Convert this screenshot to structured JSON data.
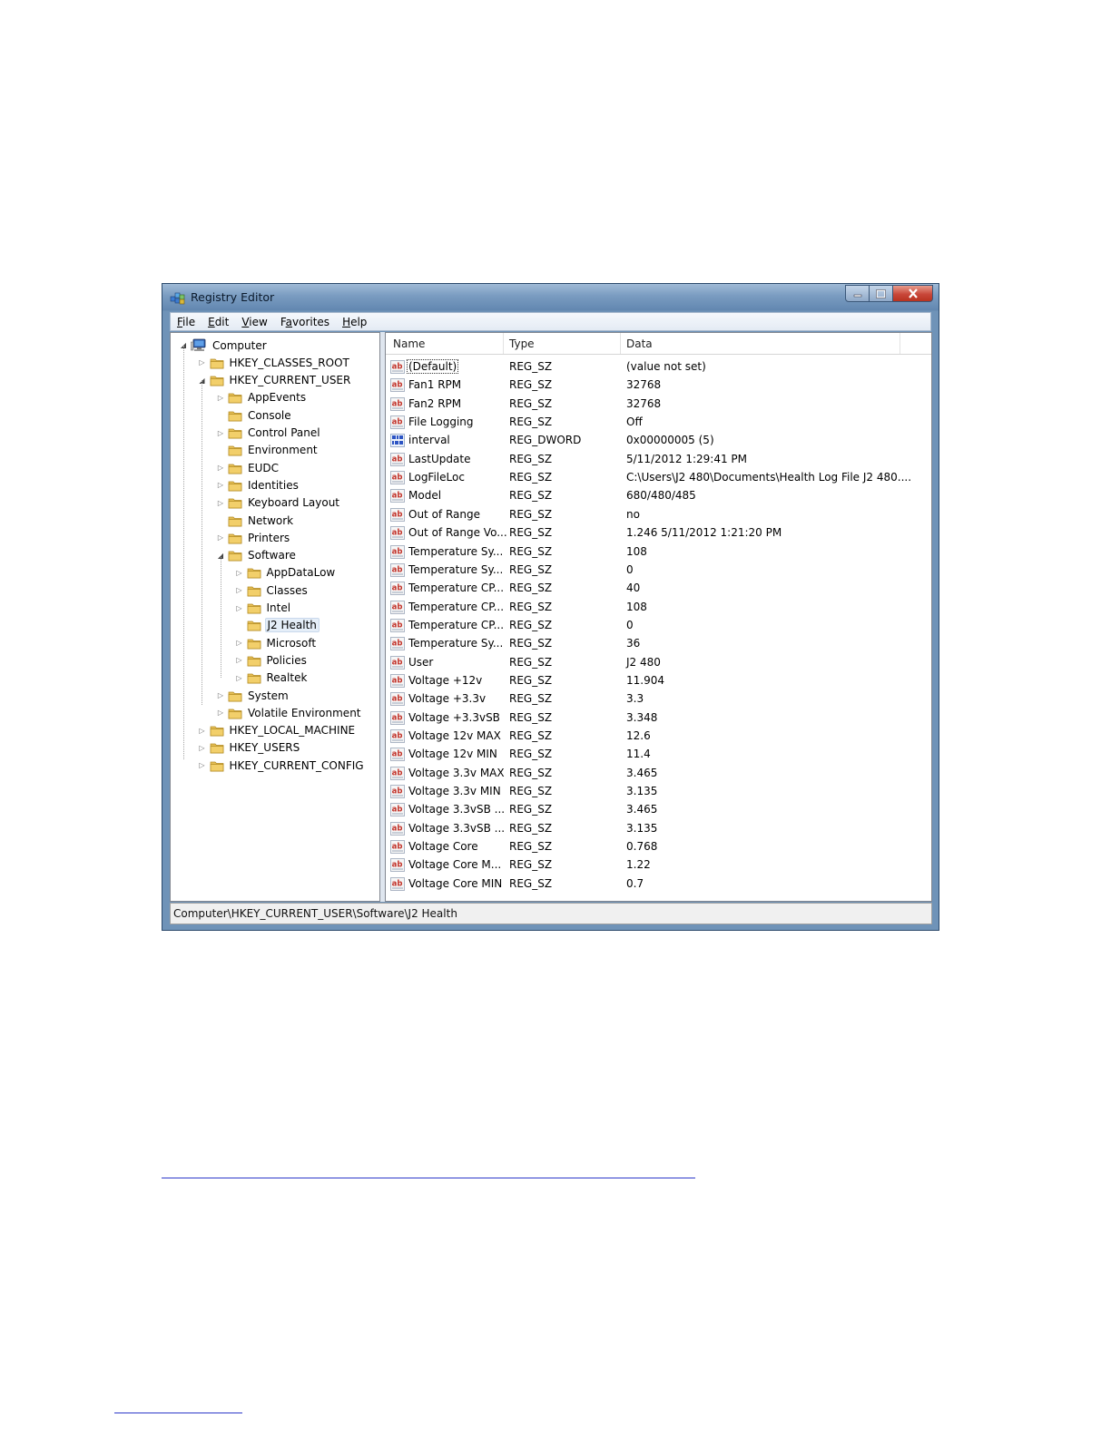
{
  "window": {
    "title": "Registry Editor"
  },
  "menu": [
    {
      "label": "File",
      "underline": "F",
      "rest": "ile"
    },
    {
      "label": "Edit",
      "underline": "E",
      "rest": "dit"
    },
    {
      "label": "View",
      "underline": "V",
      "rest": "iew"
    },
    {
      "label": "Favorites",
      "underline": "a",
      "pre": "F",
      "rest": "vorites"
    },
    {
      "label": "Help",
      "underline": "H",
      "rest": "elp"
    }
  ],
  "tree": [
    {
      "label": "Computer",
      "level": 0,
      "expander": "open",
      "icon": "computer-icon"
    },
    {
      "label": "HKEY_CLASSES_ROOT",
      "level": 1,
      "expander": "closed",
      "icon": "folder-icon"
    },
    {
      "label": "HKEY_CURRENT_USER",
      "level": 1,
      "expander": "open",
      "icon": "folder-icon"
    },
    {
      "label": "AppEvents",
      "level": 2,
      "expander": "closed",
      "icon": "folder-icon"
    },
    {
      "label": "Console",
      "level": 2,
      "expander": "none",
      "icon": "folder-icon"
    },
    {
      "label": "Control Panel",
      "level": 2,
      "expander": "closed",
      "icon": "folder-icon"
    },
    {
      "label": "Environment",
      "level": 2,
      "expander": "none",
      "icon": "folder-icon"
    },
    {
      "label": "EUDC",
      "level": 2,
      "expander": "closed",
      "icon": "folder-icon"
    },
    {
      "label": "Identities",
      "level": 2,
      "expander": "closed",
      "icon": "folder-icon"
    },
    {
      "label": "Keyboard Layout",
      "level": 2,
      "expander": "closed",
      "icon": "folder-icon"
    },
    {
      "label": "Network",
      "level": 2,
      "expander": "none",
      "icon": "folder-icon"
    },
    {
      "label": "Printers",
      "level": 2,
      "expander": "closed",
      "icon": "folder-icon"
    },
    {
      "label": "Software",
      "level": 2,
      "expander": "open",
      "icon": "folder-icon"
    },
    {
      "label": "AppDataLow",
      "level": 3,
      "expander": "closed",
      "icon": "folder-icon"
    },
    {
      "label": "Classes",
      "level": 3,
      "expander": "closed",
      "icon": "folder-icon"
    },
    {
      "label": "Intel",
      "level": 3,
      "expander": "closed",
      "icon": "folder-icon"
    },
    {
      "label": "J2 Health",
      "level": 3,
      "expander": "none",
      "icon": "folder-icon",
      "selected": true
    },
    {
      "label": "Microsoft",
      "level": 3,
      "expander": "closed",
      "icon": "folder-icon"
    },
    {
      "label": "Policies",
      "level": 3,
      "expander": "closed",
      "icon": "folder-icon"
    },
    {
      "label": "Realtek",
      "level": 3,
      "expander": "closed",
      "icon": "folder-icon"
    },
    {
      "label": "System",
      "level": 2,
      "expander": "closed",
      "icon": "folder-icon"
    },
    {
      "label": "Volatile Environment",
      "level": 2,
      "expander": "closed",
      "icon": "folder-icon"
    },
    {
      "label": "HKEY_LOCAL_MACHINE",
      "level": 1,
      "expander": "closed",
      "icon": "folder-icon"
    },
    {
      "label": "HKEY_USERS",
      "level": 1,
      "expander": "closed",
      "icon": "folder-icon"
    },
    {
      "label": "HKEY_CURRENT_CONFIG",
      "level": 1,
      "expander": "closed",
      "icon": "folder-icon"
    }
  ],
  "columns": {
    "name": "Name",
    "type": "Type",
    "data": "Data"
  },
  "values": [
    {
      "name": "(Default)",
      "type": "REG_SZ",
      "data": "(value not set)",
      "icon": "string-value-icon",
      "focused": true
    },
    {
      "name": "Fan1 RPM",
      "type": "REG_SZ",
      "data": "32768",
      "icon": "string-value-icon"
    },
    {
      "name": "Fan2 RPM",
      "type": "REG_SZ",
      "data": "32768",
      "icon": "string-value-icon"
    },
    {
      "name": "File Logging",
      "type": "REG_SZ",
      "data": "Off",
      "icon": "string-value-icon"
    },
    {
      "name": "interval",
      "type": "REG_DWORD",
      "data": "0x00000005 (5)",
      "icon": "dword-value-icon"
    },
    {
      "name": "LastUpdate",
      "type": "REG_SZ",
      "data": "5/11/2012 1:29:41 PM",
      "icon": "string-value-icon"
    },
    {
      "name": "LogFileLoc",
      "type": "REG_SZ",
      "data": "C:\\Users\\J2 480\\Documents\\Health Log File J2 480....",
      "icon": "string-value-icon"
    },
    {
      "name": "Model",
      "type": "REG_SZ",
      "data": "680/480/485",
      "icon": "string-value-icon"
    },
    {
      "name": "Out of Range",
      "type": "REG_SZ",
      "data": "no",
      "icon": "string-value-icon"
    },
    {
      "name": "Out of Range Vo...",
      "type": "REG_SZ",
      "data": "1.246  5/11/2012 1:21:20 PM",
      "icon": "string-value-icon"
    },
    {
      "name": "Temperature Sy...",
      "type": "REG_SZ",
      "data": "108",
      "icon": "string-value-icon"
    },
    {
      "name": "Temperature Sy...",
      "type": "REG_SZ",
      "data": "0",
      "icon": "string-value-icon"
    },
    {
      "name": "Temperature CP...",
      "type": "REG_SZ",
      "data": "40",
      "icon": "string-value-icon"
    },
    {
      "name": "Temperature CP...",
      "type": "REG_SZ",
      "data": "108",
      "icon": "string-value-icon"
    },
    {
      "name": "Temperature CP...",
      "type": "REG_SZ",
      "data": "0",
      "icon": "string-value-icon"
    },
    {
      "name": "Temperature Sy...",
      "type": "REG_SZ",
      "data": "36",
      "icon": "string-value-icon"
    },
    {
      "name": "User",
      "type": "REG_SZ",
      "data": "J2 480",
      "icon": "string-value-icon"
    },
    {
      "name": "Voltage +12v",
      "type": "REG_SZ",
      "data": "11.904",
      "icon": "string-value-icon"
    },
    {
      "name": "Voltage +3.3v",
      "type": "REG_SZ",
      "data": "3.3",
      "icon": "string-value-icon"
    },
    {
      "name": "Voltage +3.3vSB",
      "type": "REG_SZ",
      "data": "3.348",
      "icon": "string-value-icon"
    },
    {
      "name": "Voltage 12v MAX",
      "type": "REG_SZ",
      "data": "12.6",
      "icon": "string-value-icon"
    },
    {
      "name": "Voltage 12v MIN",
      "type": "REG_SZ",
      "data": "11.4",
      "icon": "string-value-icon"
    },
    {
      "name": "Voltage 3.3v MAX",
      "type": "REG_SZ",
      "data": "3.465",
      "icon": "string-value-icon"
    },
    {
      "name": "Voltage 3.3v MIN",
      "type": "REG_SZ",
      "data": "3.135",
      "icon": "string-value-icon"
    },
    {
      "name": "Voltage 3.3vSB ...",
      "type": "REG_SZ",
      "data": "3.465",
      "icon": "string-value-icon"
    },
    {
      "name": "Voltage 3.3vSB ...",
      "type": "REG_SZ",
      "data": "3.135",
      "icon": "string-value-icon"
    },
    {
      "name": "Voltage Core",
      "type": "REG_SZ",
      "data": "0.768",
      "icon": "string-value-icon"
    },
    {
      "name": "Voltage Core M...",
      "type": "REG_SZ",
      "data": "1.22",
      "icon": "string-value-icon"
    },
    {
      "name": "Voltage Core MIN",
      "type": "REG_SZ",
      "data": "0.7",
      "icon": "string-value-icon"
    }
  ],
  "status": {
    "path": "Computer\\HKEY_CURRENT_USER\\Software\\J2 Health"
  },
  "colors": {
    "title_gradient_top": "#9fbad6",
    "title_gradient_bottom": "#6287b0",
    "close_red": "#c8473a",
    "folder_yellow": "#f2cf6a",
    "link_blue": "#2b37c9"
  }
}
